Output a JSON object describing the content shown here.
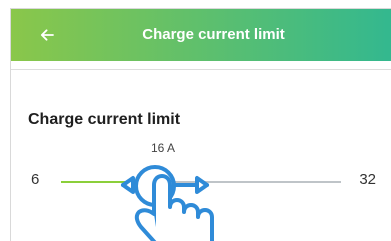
{
  "header": {
    "title": "Charge current limit",
    "back_icon": "arrow-left-icon",
    "gradient": [
      "#8ac74a",
      "#33b88f"
    ]
  },
  "setting": {
    "title": "Charge current limit",
    "value_label": "16 A",
    "min_label": "6",
    "max_label": "32",
    "value": 16,
    "min": 6,
    "max": 32,
    "fill_color": "#8bcf3a",
    "track_color": "#bfc4c8"
  },
  "gesture": {
    "icon": "swipe-gesture-icon",
    "arrow_color": "#2f8bd8"
  }
}
